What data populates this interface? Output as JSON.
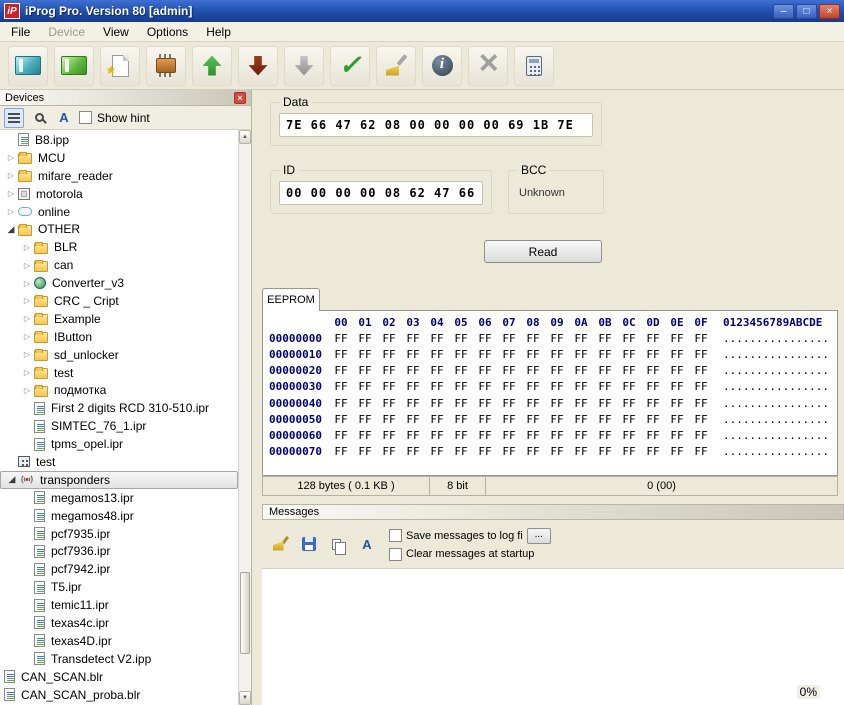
{
  "window": {
    "title": "iProg Pro. Version 80 [admin]",
    "logo_text": "iP"
  },
  "menu": {
    "items": [
      {
        "label": "File",
        "enabled": true
      },
      {
        "label": "Device",
        "enabled": false
      },
      {
        "label": "View",
        "enabled": true
      },
      {
        "label": "Options",
        "enabled": true
      },
      {
        "label": "Help",
        "enabled": true
      }
    ]
  },
  "toolbar": {
    "buttons": [
      {
        "name": "open-file",
        "icon": "open"
      },
      {
        "name": "save-file",
        "icon": "save"
      },
      {
        "name": "new-file",
        "icon": "new"
      },
      {
        "name": "chip-select",
        "icon": "chip"
      },
      {
        "name": "read-device",
        "icon": "arrow-up"
      },
      {
        "name": "write-device",
        "icon": "arrow-down"
      },
      {
        "name": "write-device-disabled",
        "icon": "arrow-down-gray"
      },
      {
        "name": "verify",
        "icon": "check"
      },
      {
        "name": "erase",
        "icon": "broom"
      },
      {
        "name": "device-info",
        "icon": "info"
      },
      {
        "name": "cancel",
        "icon": "close"
      },
      {
        "name": "calculator",
        "icon": "calc"
      }
    ]
  },
  "devices_panel": {
    "title": "Devices",
    "show_hint_label": "Show hint",
    "tree": [
      {
        "label": "B8.ipp",
        "level": 0,
        "icon": "doc",
        "arrow": null,
        "selected": false
      },
      {
        "label": "MCU",
        "level": 0,
        "icon": "folder",
        "arrow": "collapsed",
        "selected": false
      },
      {
        "label": "mifare_reader",
        "level": 0,
        "icon": "folder",
        "arrow": "collapsed",
        "selected": false
      },
      {
        "label": "motorola",
        "level": 0,
        "icon": "device",
        "arrow": "collapsed",
        "selected": false
      },
      {
        "label": "online",
        "level": 0,
        "icon": "online",
        "arrow": "collapsed",
        "selected": false
      },
      {
        "label": "OTHER",
        "level": 0,
        "icon": "folder",
        "arrow": "expanded",
        "selected": false
      },
      {
        "label": "BLR",
        "level": 1,
        "icon": "folder",
        "arrow": "collapsed",
        "selected": false
      },
      {
        "label": "can",
        "level": 1,
        "icon": "folder",
        "arrow": "collapsed",
        "selected": false
      },
      {
        "label": "Converter_v3",
        "level": 1,
        "icon": "converter",
        "arrow": "collapsed",
        "selected": false
      },
      {
        "label": "CRC _ Cript",
        "level": 1,
        "icon": "folder",
        "arrow": "collapsed",
        "selected": false
      },
      {
        "label": "Example",
        "level": 1,
        "icon": "folder",
        "arrow": "collapsed",
        "selected": false
      },
      {
        "label": "IButton",
        "level": 1,
        "icon": "folder",
        "arrow": "collapsed",
        "selected": false
      },
      {
        "label": "sd_unlocker",
        "level": 1,
        "icon": "folder",
        "arrow": "collapsed",
        "selected": false
      },
      {
        "label": "test",
        "level": 1,
        "icon": "folder",
        "arrow": "collapsed",
        "selected": false
      },
      {
        "label": "подмотка",
        "level": 1,
        "icon": "folder",
        "arrow": "collapsed",
        "selected": false
      },
      {
        "label": "First 2 digits RCD 310-510.ipr",
        "level": 1,
        "icon": "doc",
        "arrow": null,
        "selected": false
      },
      {
        "label": "SIMTEC_76_1.ipr",
        "level": 1,
        "icon": "doc",
        "arrow": null,
        "selected": false
      },
      {
        "label": "tpms_opel.ipr",
        "level": 1,
        "icon": "doc",
        "arrow": null,
        "selected": false
      },
      {
        "label": "test",
        "level": 0,
        "icon": "board",
        "arrow": null,
        "selected": false
      },
      {
        "label": "transponders",
        "level": 0,
        "icon": "transponder",
        "arrow": "expanded",
        "selected": true
      },
      {
        "label": "megamos13.ipr",
        "level": 1,
        "icon": "doc",
        "arrow": null,
        "selected": false
      },
      {
        "label": "megamos48.ipr",
        "level": 1,
        "icon": "doc",
        "arrow": null,
        "selected": false
      },
      {
        "label": "pcf7935.ipr",
        "level": 1,
        "icon": "doc",
        "arrow": null,
        "selected": false
      },
      {
        "label": "pcf7936.ipr",
        "level": 1,
        "icon": "doc",
        "arrow": null,
        "selected": false
      },
      {
        "label": "pcf7942.ipr",
        "level": 1,
        "icon": "doc",
        "arrow": null,
        "selected": false
      },
      {
        "label": "T5.ipr",
        "level": 1,
        "icon": "doc",
        "arrow": null,
        "selected": false
      },
      {
        "label": "temic11.ipr",
        "level": 1,
        "icon": "doc",
        "arrow": null,
        "selected": false
      },
      {
        "label": "texas4c.ipr",
        "level": 1,
        "icon": "doc",
        "arrow": null,
        "selected": false
      },
      {
        "label": "texas4D.ipr",
        "level": 1,
        "icon": "doc",
        "arrow": null,
        "selected": false
      },
      {
        "label": "Transdetect V2.ipp",
        "level": 1,
        "icon": "doc",
        "arrow": null,
        "selected": false
      },
      {
        "label": "CAN_SCAN.blr",
        "level": 0,
        "icon": "doc",
        "arrow": null,
        "selected": false,
        "slot": false
      },
      {
        "label": "CAN_SCAN_proba.blr",
        "level": 0,
        "icon": "doc",
        "arrow": null,
        "selected": false,
        "slot": false
      }
    ]
  },
  "groups": {
    "data": {
      "label": "Data",
      "value": "7E 66 47 62 08 00 00 00 00 69 1B 7E"
    },
    "id": {
      "label": "ID",
      "value": "00 00 00 00 08 62 47 66"
    },
    "bcc": {
      "label": "BCC",
      "value": "Unknown"
    }
  },
  "read_button": {
    "label": "Read"
  },
  "eeprom": {
    "tab_label": "EEPROM",
    "col_headers": [
      "00",
      "01",
      "02",
      "03",
      "04",
      "05",
      "06",
      "07",
      "08",
      "09",
      "0A",
      "0B",
      "0C",
      "0D",
      "0E",
      "0F"
    ],
    "ascii_header": "0123456789ABCDE",
    "rows": [
      {
        "addr": "00000000",
        "hex": "FF FF FF FF FF FF FF FF FF FF FF FF FF FF FF FF",
        "ascii": "................"
      },
      {
        "addr": "00000010",
        "hex": "FF FF FF FF FF FF FF FF FF FF FF FF FF FF FF FF",
        "ascii": "................"
      },
      {
        "addr": "00000020",
        "hex": "FF FF FF FF FF FF FF FF FF FF FF FF FF FF FF FF",
        "ascii": "................"
      },
      {
        "addr": "00000030",
        "hex": "FF FF FF FF FF FF FF FF FF FF FF FF FF FF FF FF",
        "ascii": "................"
      },
      {
        "addr": "00000040",
        "hex": "FF FF FF FF FF FF FF FF FF FF FF FF FF FF FF FF",
        "ascii": "................"
      },
      {
        "addr": "00000050",
        "hex": "FF FF FF FF FF FF FF FF FF FF FF FF FF FF FF FF",
        "ascii": "................"
      },
      {
        "addr": "00000060",
        "hex": "FF FF FF FF FF FF FF FF FF FF FF FF FF FF FF FF",
        "ascii": "................"
      },
      {
        "addr": "00000070",
        "hex": "FF FF FF FF FF FF FF FF FF FF FF FF FF FF FF FF",
        "ascii": "................"
      }
    ],
    "status": {
      "size": "128 bytes ( 0.1 KB )",
      "bits": "8 bit",
      "value": "0 (00)"
    }
  },
  "messages": {
    "title": "Messages",
    "save_to_log_label": "Save messages to log fi",
    "browse_label": "...",
    "clear_label": "Clear messages at startup",
    "progress": "0%"
  }
}
